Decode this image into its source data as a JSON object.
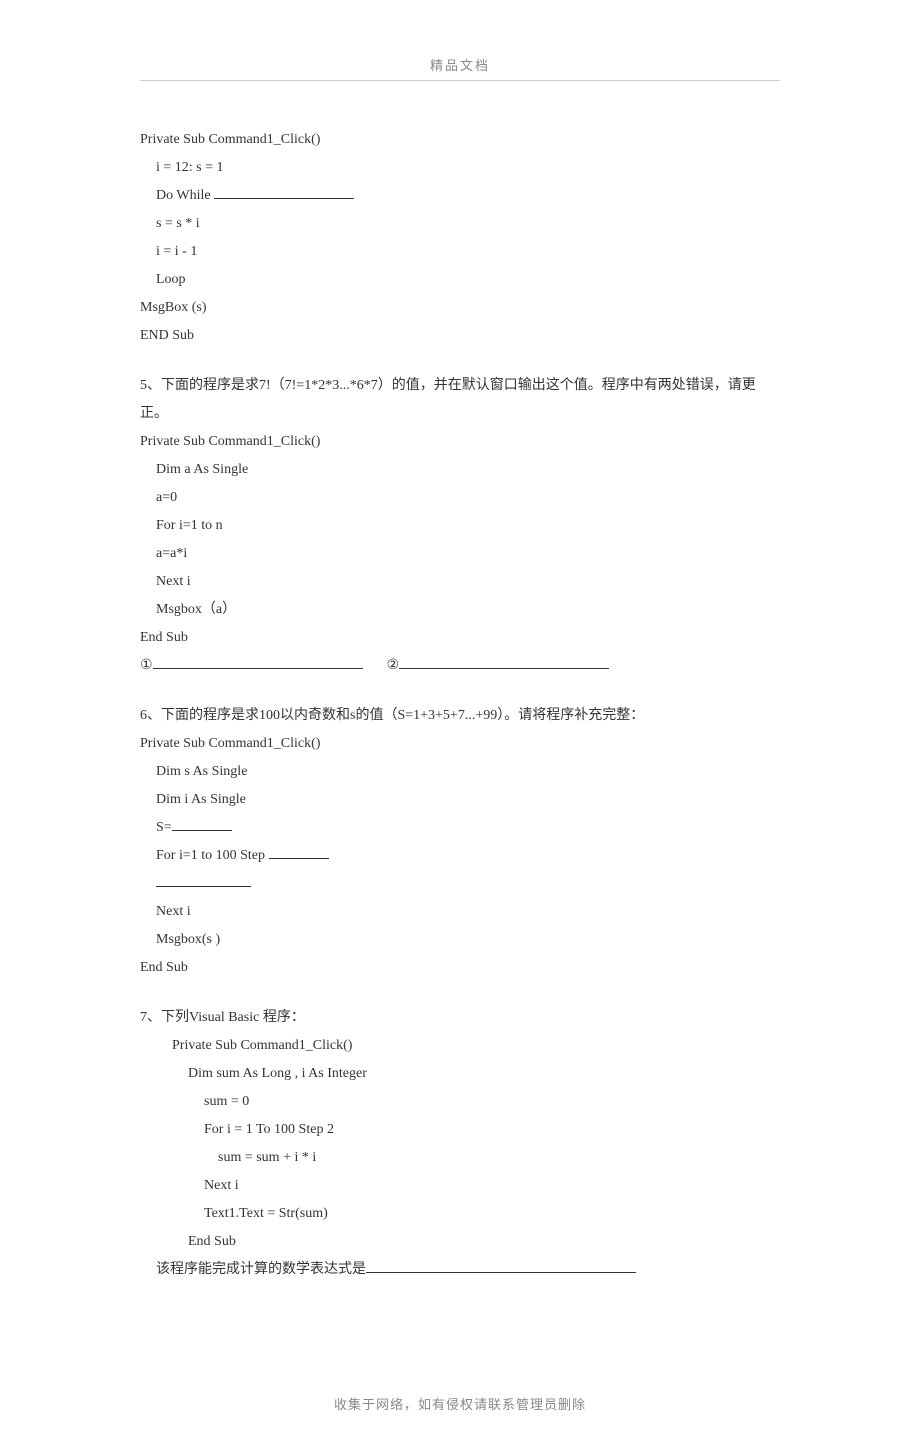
{
  "header": {
    "title": "精品文档"
  },
  "block1": {
    "line1": "Private Sub Command1_Click()",
    "line2": "i = 12: s = 1",
    "line3": "Do While ",
    "line4": "s = s * i",
    "line5": "i = i - 1",
    "line6": "Loop",
    "line7": "MsgBox (s)",
    "line8": "END Sub"
  },
  "q5": {
    "intro": "5、下面的程序是求7!（7!=1*2*3...*6*7）的值，并在默认窗口输出这个值。程序中有两处错误，请更正。",
    "line1": "Private Sub Command1_Click()",
    "line2": "Dim a As Single",
    "line3": "a=0",
    "line4": "For i=1 to n",
    "line5": "a=a*i",
    "line6": "Next i",
    "line7": "Msgbox（a）",
    "line8": "End Sub",
    "mark1": "①",
    "mark2": "②"
  },
  "q6": {
    "intro": "6、下面的程序是求100以内奇数和s的值（S=1+3+5+7...+99）。请将程序补充完整：",
    "line1": "Private Sub Command1_Click()",
    "line2": "Dim s As Single",
    "line3": "Dim i As Single",
    "line4": "S=",
    "line5": "For i=1 to 100 Step ",
    "line6": "Next i",
    "line7": "Msgbox(s )",
    "line8": "End Sub"
  },
  "q7": {
    "intro": "7、下列Visual Basic 程序：",
    "line1": "Private Sub Command1_Click()",
    "line2": "Dim sum As Long , i As Integer",
    "line3": "sum = 0",
    "line4": "For i = 1 To 100 Step 2",
    "line5": "sum = sum + i * i",
    "line6": "Next i",
    "line7": "Text1.Text = Str(sum)",
    "line8": "End Sub",
    "question": "该程序能完成计算的数学表达式是"
  },
  "footer": {
    "text": "收集于网络，如有侵权请联系管理员删除"
  }
}
